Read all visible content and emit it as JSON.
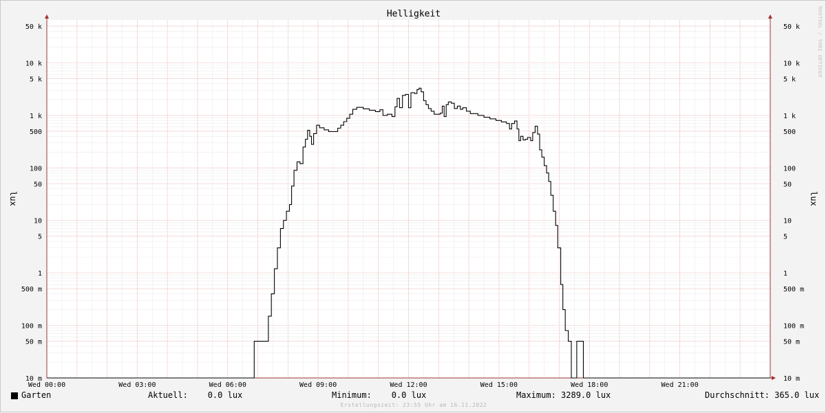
{
  "chart_data": {
    "type": "line",
    "title": "Helligkeit",
    "ylabel": "lux",
    "yscale": "log",
    "ylim": [
      0.01,
      50000
    ],
    "y_ticks": [
      {
        "value": 0.01,
        "label": "10 m"
      },
      {
        "value": 0.05,
        "label": "50 m"
      },
      {
        "value": 0.1,
        "label": "100 m"
      },
      {
        "value": 0.5,
        "label": "500 m"
      },
      {
        "value": 1,
        "label": "1"
      },
      {
        "value": 5,
        "label": "5"
      },
      {
        "value": 10,
        "label": "10"
      },
      {
        "value": 50,
        "label": "50"
      },
      {
        "value": 100,
        "label": "100"
      },
      {
        "value": 500,
        "label": "500"
      },
      {
        "value": 1000,
        "label": "1 k"
      },
      {
        "value": 5000,
        "label": "5 k"
      },
      {
        "value": 10000,
        "label": "10 k"
      },
      {
        "value": 50000,
        "label": "50 k"
      }
    ],
    "x_ticks": [
      {
        "hour": 0,
        "label": "Wed 00:00"
      },
      {
        "hour": 3,
        "label": "Wed 03:00"
      },
      {
        "hour": 6,
        "label": "Wed 06:00"
      },
      {
        "hour": 9,
        "label": "Wed 09:00"
      },
      {
        "hour": 12,
        "label": "Wed 12:00"
      },
      {
        "hour": 15,
        "label": "Wed 15:00"
      },
      {
        "hour": 18,
        "label": "Wed 18:00"
      },
      {
        "hour": 21,
        "label": "Wed 21:00"
      }
    ],
    "xlim_hours": [
      0,
      24
    ],
    "grid": true,
    "series": [
      {
        "name": "Garten",
        "color": "#000000",
        "step": true,
        "points": [
          [
            0,
            0.01
          ],
          [
            6.83,
            0.01
          ],
          [
            6.88,
            0.05
          ],
          [
            7.3,
            0.05
          ],
          [
            7.35,
            0.15
          ],
          [
            7.45,
            0.4
          ],
          [
            7.55,
            1.2
          ],
          [
            7.65,
            3
          ],
          [
            7.75,
            7
          ],
          [
            7.85,
            10
          ],
          [
            7.95,
            15
          ],
          [
            8.05,
            20
          ],
          [
            8.12,
            45
          ],
          [
            8.2,
            90
          ],
          [
            8.3,
            130
          ],
          [
            8.4,
            120
          ],
          [
            8.5,
            250
          ],
          [
            8.58,
            350
          ],
          [
            8.65,
            520
          ],
          [
            8.72,
            400
          ],
          [
            8.78,
            280
          ],
          [
            8.85,
            450
          ],
          [
            8.95,
            650
          ],
          [
            9.05,
            580
          ],
          [
            9.2,
            530
          ],
          [
            9.35,
            490
          ],
          [
            9.55,
            490
          ],
          [
            9.65,
            570
          ],
          [
            9.75,
            650
          ],
          [
            9.85,
            760
          ],
          [
            9.95,
            880
          ],
          [
            10.05,
            1050
          ],
          [
            10.15,
            1300
          ],
          [
            10.28,
            1420
          ],
          [
            10.5,
            1330
          ],
          [
            10.7,
            1250
          ],
          [
            10.9,
            1180
          ],
          [
            11.05,
            1280
          ],
          [
            11.15,
            1000
          ],
          [
            11.3,
            1050
          ],
          [
            11.45,
            950
          ],
          [
            11.55,
            1450
          ],
          [
            11.62,
            2100
          ],
          [
            11.7,
            1400
          ],
          [
            11.8,
            2400
          ],
          [
            11.9,
            2500
          ],
          [
            12.0,
            1400
          ],
          [
            12.08,
            2700
          ],
          [
            12.2,
            2600
          ],
          [
            12.28,
            3100
          ],
          [
            12.35,
            3289
          ],
          [
            12.42,
            2800
          ],
          [
            12.5,
            1900
          ],
          [
            12.58,
            1600
          ],
          [
            12.66,
            1350
          ],
          [
            12.75,
            1200
          ],
          [
            12.85,
            1050
          ],
          [
            13.05,
            1100
          ],
          [
            13.12,
            1500
          ],
          [
            13.18,
            950
          ],
          [
            13.25,
            1600
          ],
          [
            13.32,
            1800
          ],
          [
            13.42,
            1700
          ],
          [
            13.52,
            1350
          ],
          [
            13.62,
            1500
          ],
          [
            13.72,
            1300
          ],
          [
            13.8,
            1400
          ],
          [
            13.92,
            1200
          ],
          [
            14.05,
            1080
          ],
          [
            14.3,
            1000
          ],
          [
            14.5,
            920
          ],
          [
            14.7,
            860
          ],
          [
            14.9,
            800
          ],
          [
            15.08,
            750
          ],
          [
            15.25,
            700
          ],
          [
            15.35,
            550
          ],
          [
            15.42,
            700
          ],
          [
            15.52,
            780
          ],
          [
            15.6,
            550
          ],
          [
            15.66,
            330
          ],
          [
            15.72,
            400
          ],
          [
            15.8,
            340
          ],
          [
            15.88,
            350
          ],
          [
            15.95,
            380
          ],
          [
            16.05,
            330
          ],
          [
            16.12,
            470
          ],
          [
            16.2,
            620
          ],
          [
            16.28,
            440
          ],
          [
            16.35,
            220
          ],
          [
            16.42,
            160
          ],
          [
            16.5,
            110
          ],
          [
            16.58,
            80
          ],
          [
            16.65,
            55
          ],
          [
            16.72,
            30
          ],
          [
            16.8,
            15
          ],
          [
            16.88,
            8
          ],
          [
            16.95,
            3
          ],
          [
            17.05,
            0.6
          ],
          [
            17.12,
            0.2
          ],
          [
            17.2,
            0.08
          ],
          [
            17.3,
            0.05
          ],
          [
            17.4,
            0.01
          ],
          [
            17.58,
            0.05
          ],
          [
            17.8,
            0.01
          ],
          [
            24,
            0.01
          ]
        ]
      }
    ]
  },
  "legend": {
    "series_name": "Garten",
    "current": "Aktuell:    0.0 lux",
    "minimum": "Minimum:    0.0 lux",
    "maximum": "Maximum: 3289.0 lux",
    "average": "Durchschnitt: 365.0 lux"
  },
  "watermark": "RRDTOOL / TOBI OETIKER",
  "footer": "Erstellungszeit: 23:55 Uhr am 16.11.2022",
  "colors": {
    "background": "#f3f3f3",
    "plot_background": "#ffffff",
    "major_grid": "#e7a0a0",
    "minor_grid": "#d8d8d8",
    "axis": "#a03030",
    "line": "#000000"
  }
}
